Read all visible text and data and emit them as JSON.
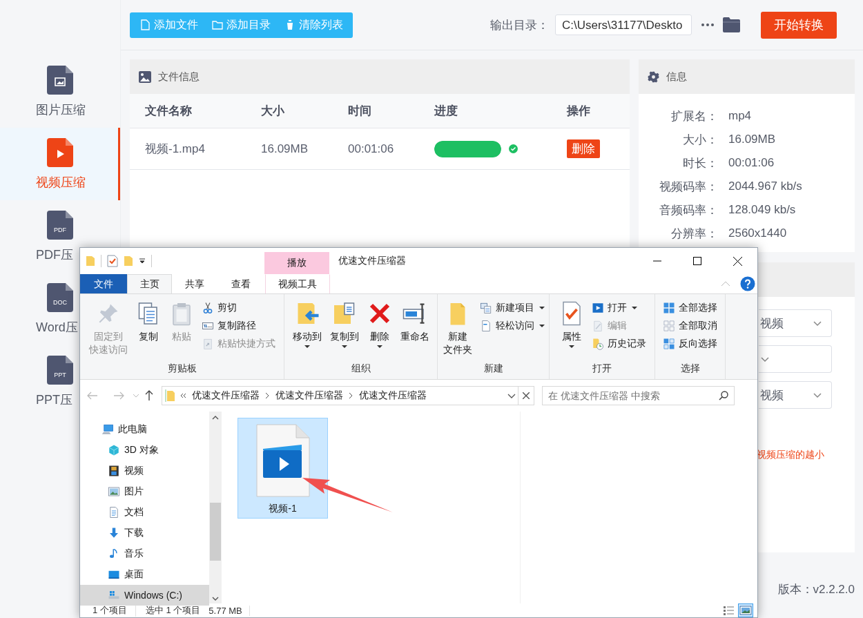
{
  "sidebar": {
    "items": [
      {
        "label": "图片压缩",
        "kind": "image",
        "selected": false
      },
      {
        "label": "视频压缩",
        "kind": "video",
        "selected": true
      },
      {
        "label": "PDF压",
        "kind": "badge",
        "badge": "PDF",
        "selected": false
      },
      {
        "label": "Word压",
        "kind": "badge",
        "badge": "DOC",
        "selected": false
      },
      {
        "label": "PPT压",
        "kind": "badge",
        "badge": "PPT",
        "selected": false
      }
    ]
  },
  "toolbar": {
    "buttons": [
      {
        "label": "添加文件",
        "kind": "file"
      },
      {
        "label": "添加目录",
        "kind": "folder"
      },
      {
        "label": "清除列表",
        "kind": "trash"
      }
    ],
    "output_label": "输出目录：",
    "output_path": "C:\\Users\\31177\\Deskto",
    "start_button": "开始转换"
  },
  "file_panel": {
    "title": "文件信息",
    "columns": [
      "文件名称",
      "大小",
      "时间",
      "进度",
      "操作"
    ],
    "rows": [
      {
        "name": "视频-1.mp4",
        "size": "16.09MB",
        "time": "00:01:06",
        "level": 1,
        "done": true,
        "action": "删除"
      }
    ]
  },
  "info_panel": {
    "title": "信息",
    "fields": [
      {
        "label": "扩展名：",
        "value": "mp4"
      },
      {
        "label": "大小：",
        "value": "16.09MB"
      },
      {
        "label": "时长：",
        "value": "00:01:06"
      },
      {
        "label": "视频码率：",
        "value": "2044.967 kb/s"
      },
      {
        "label": "音频码率：",
        "value": "128.049 kb/s"
      },
      {
        "label": "分辨率：",
        "value": "2560x1440"
      }
    ]
  },
  "settings": {
    "dropdowns": [
      {
        "kind": "text",
        "value": "视频"
      },
      {
        "kind": "empty"
      },
      {
        "kind": "text",
        "value": "视频"
      }
    ],
    "hint": "视频压缩的越小"
  },
  "version": "版本：v2.2.2.0",
  "explorer": {
    "title": "优速文件压缩器",
    "context_tab": "播放",
    "tabs": [
      {
        "label": "文件",
        "kind": "menu",
        "selected": false
      },
      {
        "label": "主页",
        "kind": "tab",
        "selected": true
      },
      {
        "label": "共享",
        "kind": "tab",
        "selected": false
      },
      {
        "label": "查看",
        "kind": "tab",
        "selected": false
      },
      {
        "label": "视频工具",
        "kind": "context",
        "selected": false
      }
    ],
    "ribbon": [
      {
        "title": "剪贴板",
        "items": [
          {
            "lines": [
              "固定到",
              "快速访问"
            ],
            "kind": "large",
            "menu": false,
            "disabled": true
          },
          {
            "lines": [
              "复制"
            ],
            "kind": "large",
            "menu": false,
            "disabled": false
          },
          {
            "lines": [
              "粘贴"
            ],
            "kind": "large",
            "menu": false,
            "disabled": true
          },
          {
            "lines": [
              "剪切"
            ],
            "kind": "small",
            "menu": false,
            "disabled": false
          },
          {
            "lines": [
              "复制路径"
            ],
            "kind": "small",
            "menu": false,
            "disabled": false
          },
          {
            "lines": [
              "粘贴快捷方式"
            ],
            "kind": "small",
            "menu": false,
            "disabled": true
          }
        ]
      },
      {
        "title": "组织",
        "items": [
          {
            "lines": [
              "移动到"
            ],
            "kind": "large",
            "menu": true,
            "disabled": false
          },
          {
            "lines": [
              "复制到"
            ],
            "kind": "large",
            "menu": true,
            "disabled": false
          },
          {
            "lines": [
              "删除"
            ],
            "kind": "large",
            "menu": true,
            "disabled": false
          },
          {
            "lines": [
              "重命名"
            ],
            "kind": "large",
            "menu": false,
            "disabled": false
          }
        ]
      },
      {
        "title": "新建",
        "items": [
          {
            "lines": [
              "新建",
              "文件夹"
            ],
            "kind": "large",
            "menu": false,
            "disabled": false
          },
          {
            "lines": [
              "新建项目"
            ],
            "kind": "small",
            "menu": true,
            "disabled": false
          },
          {
            "lines": [
              "轻松访问"
            ],
            "kind": "small",
            "menu": true,
            "disabled": false
          }
        ]
      },
      {
        "title": "打开",
        "items": [
          {
            "lines": [
              "属性"
            ],
            "kind": "large",
            "menu": true,
            "disabled": false
          },
          {
            "lines": [
              "打开"
            ],
            "kind": "small",
            "menu": true,
            "disabled": false
          },
          {
            "lines": [
              "编辑"
            ],
            "kind": "small",
            "menu": false,
            "disabled": true
          },
          {
            "lines": [
              "历史记录"
            ],
            "kind": "small",
            "menu": false,
            "disabled": false
          }
        ]
      },
      {
        "title": "选择",
        "items": [
          {
            "lines": [
              "全部选择"
            ],
            "kind": "small",
            "menu": false,
            "disabled": false
          },
          {
            "lines": [
              "全部取消"
            ],
            "kind": "small",
            "menu": false,
            "disabled": false
          },
          {
            "lines": [
              "反向选择"
            ],
            "kind": "small",
            "menu": false,
            "disabled": false
          }
        ]
      }
    ],
    "path": [
      "优速文件压缩器",
      "优速文件压缩器",
      "优速文件压缩器"
    ],
    "search_placeholder": "在 优速文件压缩器 中搜索",
    "nav": [
      {
        "label": "此电脑",
        "kind": "pc",
        "selected": false,
        "children": [
          {
            "label": "3D 对象",
            "kind": "cube",
            "selected": false
          },
          {
            "label": "视频",
            "kind": "film",
            "selected": false
          },
          {
            "label": "图片",
            "kind": "pictures",
            "selected": false
          },
          {
            "label": "文档",
            "kind": "docs",
            "selected": false
          },
          {
            "label": "下载",
            "kind": "download",
            "selected": false
          },
          {
            "label": "音乐",
            "kind": "music",
            "selected": false
          },
          {
            "label": "桌面",
            "kind": "desktop",
            "selected": false
          },
          {
            "label": "Windows (C:)",
            "kind": "drive",
            "selected": true
          }
        ]
      }
    ],
    "files": [
      {
        "name": "视频-1",
        "selected": true
      }
    ],
    "status": {
      "count": "1 个项目",
      "selection": "选中 1 个项目",
      "size": "5.77 MB"
    },
    "views": [
      {
        "kind": "details",
        "selected": false
      },
      {
        "kind": "tiles",
        "selected": true
      }
    ]
  }
}
